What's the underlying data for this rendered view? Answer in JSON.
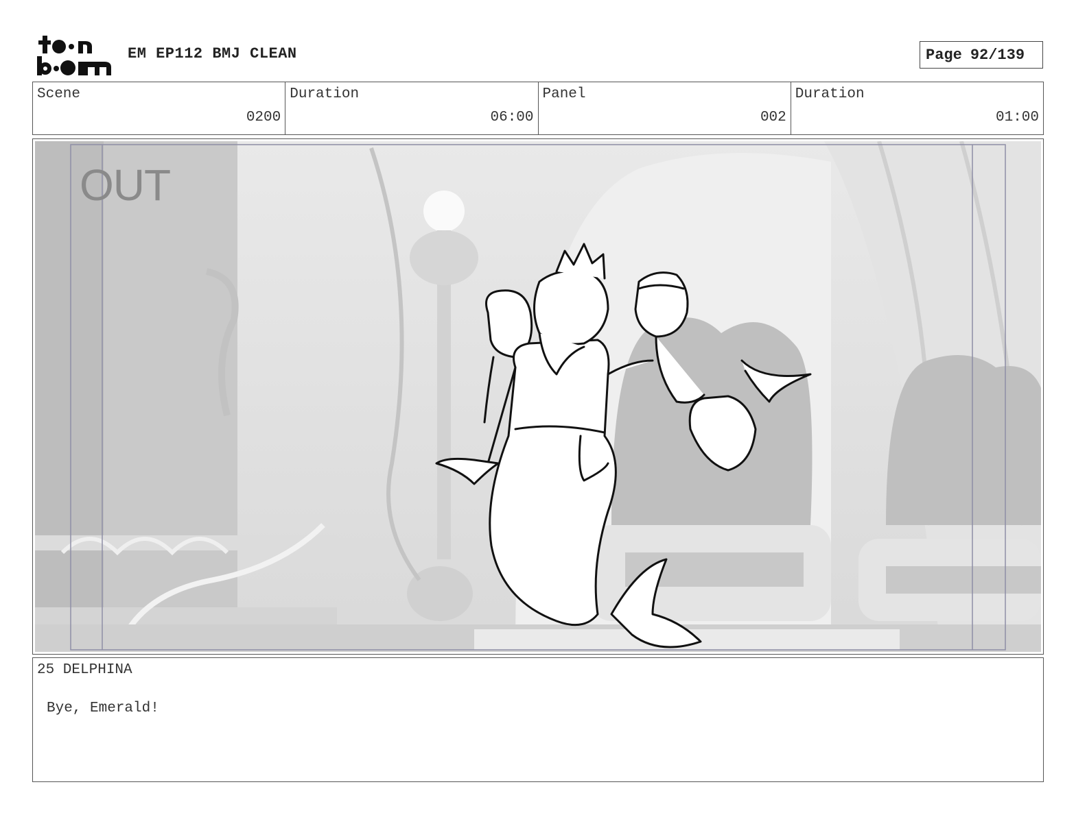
{
  "header": {
    "logo_text": "toon boom",
    "title": "EM EP112 BMJ CLEAN",
    "page_label": "Page",
    "page_number": "92/139"
  },
  "info": {
    "scene_label": "Scene",
    "scene_value": "0200",
    "scene_duration_label": "Duration",
    "scene_duration_value": "06:00",
    "panel_label": "Panel",
    "panel_value": "002",
    "panel_duration_label": "Duration",
    "panel_duration_value": "01:00"
  },
  "panel": {
    "camera_label": "OUT"
  },
  "dialogue": {
    "speaker": "25 DELPHINA",
    "line": "Bye, Emerald!"
  }
}
